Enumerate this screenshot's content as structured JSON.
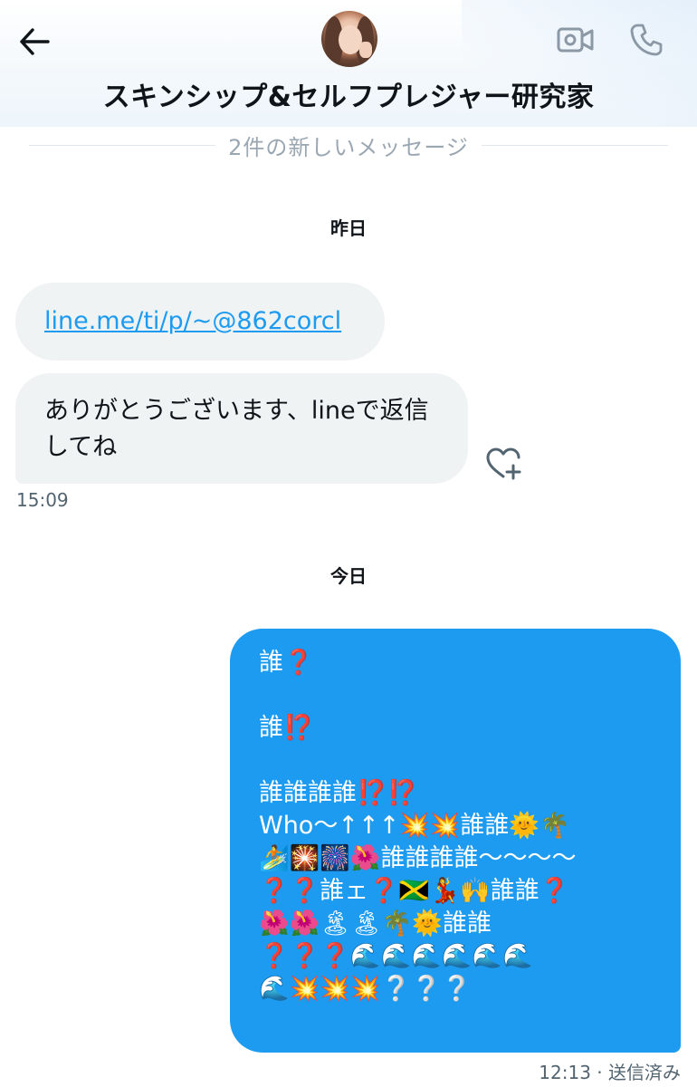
{
  "header": {
    "back_icon": "arrow-left-icon",
    "contact_name": "スキンシップ&セルフプレジャー研究家",
    "video_icon": "video-camera-icon",
    "call_icon": "phone-icon"
  },
  "new_messages_divider": "2件の新しいメッセージ",
  "days": {
    "yesterday": "昨日",
    "today": "今日"
  },
  "received": {
    "link_text": "line.me/ti/p/~@862corcl",
    "message_text": "ありがとうございます、lineで返信してね",
    "time": "15:09",
    "react_icon": "heart-plus-icon"
  },
  "sent": {
    "message_text": "誰❓\n\n誰⁉️\n\n誰誰誰誰⁉️⁉️\nWho〜↑↑↑💥💥誰誰🌞🌴\n🏄🎇🎆🌺誰誰誰誰〜〜〜〜\n❓❓誰ェ❓🇯🇲💃🙌誰誰❓\n🌺🌺🏝🏝🌴🌞誰誰\n❓❓❓🌊🌊🌊🌊🌊🌊\n🌊💥💥💥❔❔❔",
    "status": "12:13 · 送信済み"
  },
  "colors": {
    "accent": "#1d9bf0",
    "incoming_bubble": "#eff3f4",
    "muted_text": "#536471"
  }
}
